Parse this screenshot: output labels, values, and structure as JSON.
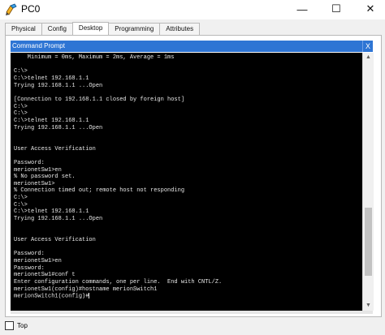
{
  "window": {
    "title": "PC0",
    "min_glyph": "—",
    "max_glyph": "☐",
    "close_glyph": "✕"
  },
  "tabs": [
    {
      "label": "Physical",
      "active": false
    },
    {
      "label": "Config",
      "active": false
    },
    {
      "label": "Desktop",
      "active": true
    },
    {
      "label": "Programming",
      "active": false
    },
    {
      "label": "Attributes",
      "active": false
    }
  ],
  "command_prompt": {
    "title": "Command Prompt",
    "close_label": "X",
    "lines": [
      "    Minimum = 0ms, Maximum = 2ms, Average = 1ms",
      "",
      "C:\\>",
      "C:\\>telnet 192.168.1.1",
      "Trying 192.168.1.1 ...Open",
      "",
      "[Connection to 192.168.1.1 closed by foreign host]",
      "C:\\>",
      "C:\\>",
      "C:\\>telnet 192.168.1.1",
      "Trying 192.168.1.1 ...Open",
      "",
      "",
      "User Access Verification",
      "",
      "Password:",
      "merionetSw1>en",
      "% No password set.",
      "merionetSw1>",
      "% Connection timed out; remote host not responding",
      "C:\\>",
      "C:\\>",
      "C:\\>telnet 192.168.1.1",
      "Trying 192.168.1.1 ...Open",
      "",
      "",
      "User Access Verification",
      "",
      "Password:",
      "merionetSw1>en",
      "Password:",
      "merionetSw1#conf t",
      "Enter configuration commands, one per line.  End with CNTL/Z.",
      "merionetSw1(config)#hostname merionSwitch1",
      "merionSwitch1(config)#"
    ]
  },
  "scrollbar": {
    "up_glyph": "▲",
    "down_glyph": "▼",
    "position_fraction": 0.85
  },
  "footer": {
    "top_label": "Top",
    "top_checked": false
  },
  "colors": {
    "header_blue": "#2e75d4",
    "terminal_bg": "#000000",
    "terminal_text": "#e8e8e8"
  }
}
